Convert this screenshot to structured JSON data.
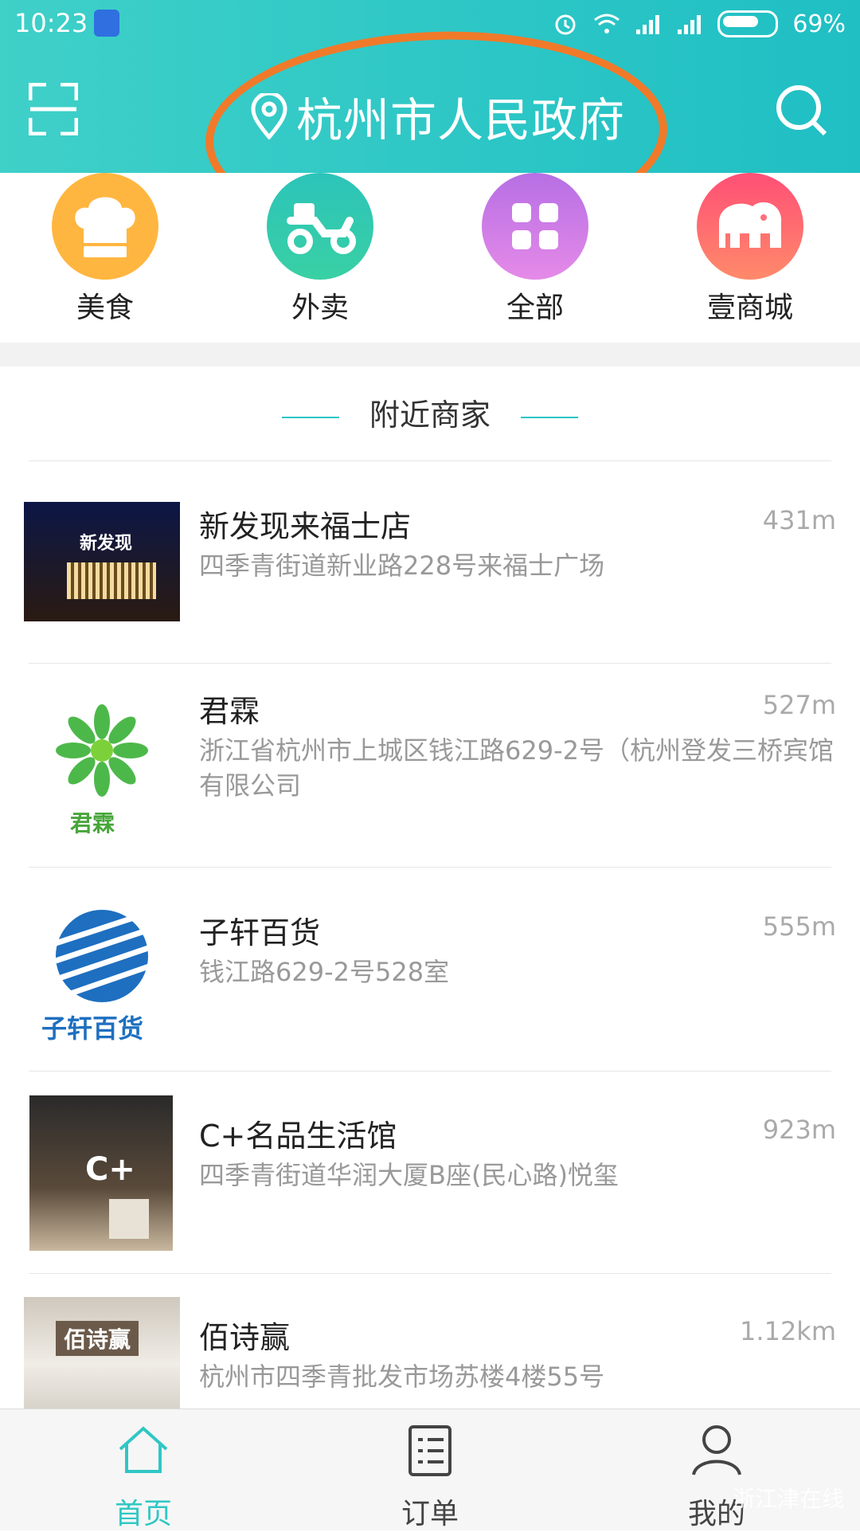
{
  "status_bar": {
    "time": "10:23",
    "battery": "69%"
  },
  "header": {
    "location": "杭州市人民政府"
  },
  "categories": [
    {
      "label": "美食",
      "icon": "chef-hat-icon",
      "color": "#ffb640"
    },
    {
      "label": "外卖",
      "icon": "delivery-scooter-icon",
      "color": "#27c8b0"
    },
    {
      "label": "全部",
      "icon": "grid-icon",
      "color": "#c577e6"
    },
    {
      "label": "壹商城",
      "icon": "elephant-icon",
      "color": "#ff6e7d"
    }
  ],
  "section": {
    "title": "附近商家"
  },
  "stores": [
    {
      "name": "新发现来福士店",
      "address": "四季青街道新业路228号来福士广场",
      "distance": "431m",
      "thumb_text": "新发现"
    },
    {
      "name": "君霖",
      "address": "浙江省杭州市上城区钱江路629-2号（杭州登发三桥宾馆有限公司",
      "distance": "527m",
      "thumb_text": "君霖"
    },
    {
      "name": "子轩百货",
      "address": "钱江路629-2号528室",
      "distance": "555m",
      "thumb_text": "子轩百货"
    },
    {
      "name": "C+名品生活馆",
      "address": "四季青街道华润大厦B座(民心路)悦玺",
      "distance": "923m",
      "thumb_text": "C+"
    },
    {
      "name": "佰诗赢",
      "address": "杭州市四季青批发市场苏楼4楼55号",
      "distance": "1.12km",
      "thumb_text": "佰诗赢"
    }
  ],
  "tabs": [
    {
      "label": "首页",
      "icon": "home-icon"
    },
    {
      "label": "订单",
      "icon": "list-icon"
    },
    {
      "label": "我的",
      "icon": "user-icon"
    }
  ],
  "watermark": "浙江津在线",
  "colors": {
    "accent": "#2fc7c4",
    "annotation": "#f07a2a"
  }
}
